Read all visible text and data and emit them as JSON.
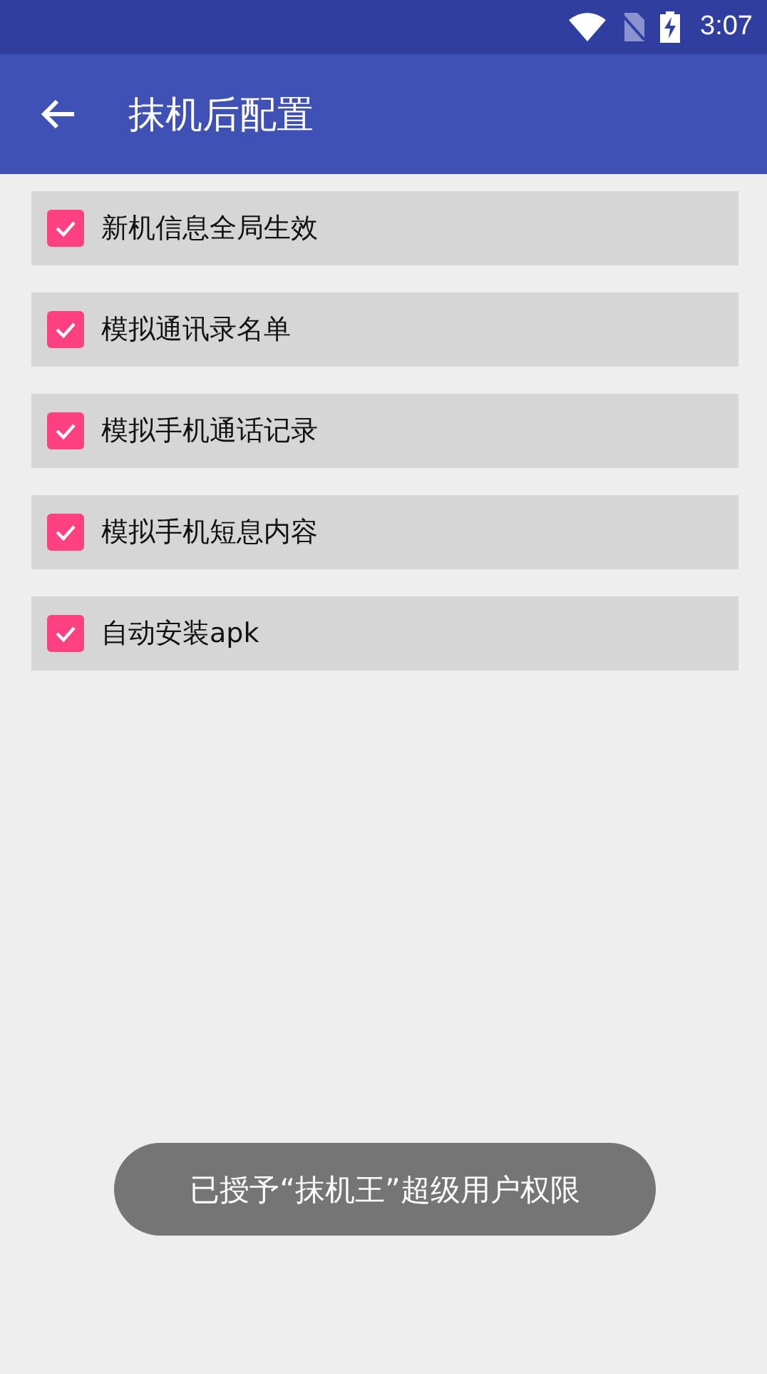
{
  "status_bar": {
    "time": "3:07"
  },
  "app_bar": {
    "title": "抹机后配置"
  },
  "options": [
    {
      "label": "新机信息全局生效",
      "checked": true
    },
    {
      "label": "模拟通讯录名单",
      "checked": true
    },
    {
      "label": "模拟手机通话记录",
      "checked": true
    },
    {
      "label": "模拟手机短息内容",
      "checked": true
    },
    {
      "label": "自动安装apk",
      "checked": true
    }
  ],
  "toast": {
    "text": "已授予“抹机王”超级用户权限"
  }
}
